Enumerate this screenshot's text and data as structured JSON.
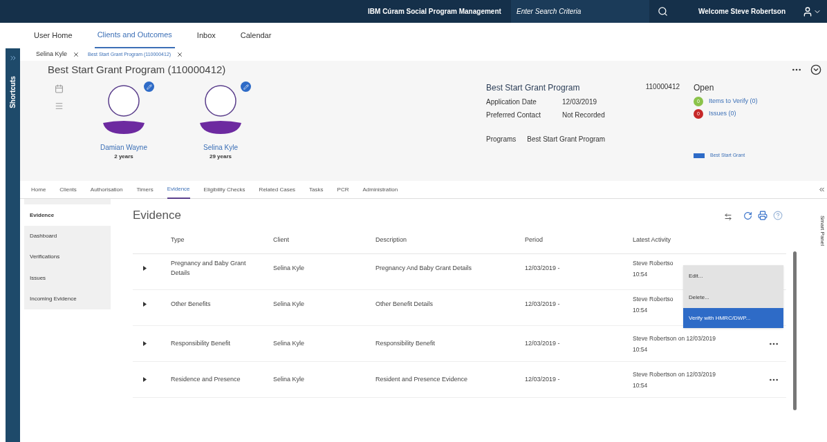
{
  "top_bar": {
    "product": "IBM Cúram Social Program Management",
    "search": {
      "placeholder": "Enter Search Criteria"
    },
    "welcome": "Welcome Steve Robertson"
  },
  "nav_tabs": [
    {
      "label": "User Home",
      "selected": false
    },
    {
      "label": "Clients and Outcomes",
      "selected": true
    },
    {
      "label": "Inbox",
      "selected": false
    },
    {
      "label": "Calendar",
      "selected": false
    }
  ],
  "shortcuts": {
    "label": "Shortcuts"
  },
  "open_tabs": [
    {
      "label": "Selina Kyle",
      "selected": false
    },
    {
      "label": "Best Start Grant Program (110000412)",
      "selected": true
    }
  ],
  "page_title": "Best Start Grant Program (110000412)",
  "clients": [
    {
      "name": "Damian Wayne",
      "age": "2 years"
    },
    {
      "name": "Selina Kyle",
      "age": "29 years"
    }
  ],
  "case": {
    "title": "Best Start Grant Program",
    "reference": "110000412",
    "fields": [
      {
        "label": "Application Date",
        "value": "12/03/2019"
      },
      {
        "label": "Preferred Contact",
        "value": "Not Recorded"
      }
    ],
    "programs_label": "Programs",
    "programs_value": "Best Start Grant Program"
  },
  "status": {
    "label": "Open",
    "links": [
      {
        "badge": "0",
        "text": "Items to Verify (0)",
        "color": "#8bc34a"
      },
      {
        "badge": "0",
        "text": "Issues (0)",
        "color": "#c62828"
      }
    ],
    "tag": "Best Start Grant"
  },
  "case_tabs": [
    {
      "label": "Home",
      "selected": false
    },
    {
      "label": "Clients",
      "selected": false
    },
    {
      "label": "Authorisation",
      "selected": false
    },
    {
      "label": "Timers",
      "selected": false
    },
    {
      "label": "Evidence",
      "selected": true
    },
    {
      "label": "Eligibility Checks",
      "selected": false
    },
    {
      "label": "Related Cases",
      "selected": false
    },
    {
      "label": "Tasks",
      "selected": false
    },
    {
      "label": "PCR",
      "selected": false
    },
    {
      "label": "Administration",
      "selected": false
    }
  ],
  "side_nav": [
    {
      "label": "Evidence",
      "selected": true
    },
    {
      "label": "Dashboard",
      "selected": false
    },
    {
      "label": "Verifications",
      "selected": false
    },
    {
      "label": "Issues",
      "selected": false
    },
    {
      "label": "Incoming Evidence",
      "selected": false
    }
  ],
  "evidence": {
    "title": "Evidence",
    "columns": [
      "Type",
      "Client",
      "Description",
      "Period",
      "Latest Activity"
    ],
    "rows": [
      {
        "type": "Pregnancy and Baby Grant Details",
        "client": "Selina Kyle",
        "description": "Pregnancy And Baby Grant Details",
        "period": "12/03/2019 -",
        "activity": "Steve Robertso",
        "time": "10:54",
        "menu_button": false
      },
      {
        "type": "Other Benefits",
        "client": "Selina Kyle",
        "description": "Other Benefit Details",
        "period": "12/03/2019 -",
        "activity": "Steve Robertso",
        "time": "10:54",
        "menu_button": false
      },
      {
        "type": "Responsibility Benefit",
        "client": "Selina Kyle",
        "description": "Responsibility Benefit",
        "period": "12/03/2019 -",
        "activity": "Steve Robertson on 12/03/2019",
        "time": "10:54",
        "menu_button": true
      },
      {
        "type": "Residence and Presence",
        "client": "Selina Kyle",
        "description": "Resident and Presence Evidence",
        "period": "12/03/2019 -",
        "activity": "Steve Robertson on 12/03/2019",
        "time": "10:54",
        "menu_button": true
      }
    ],
    "menu": [
      {
        "label": "Edit...",
        "selected": false
      },
      {
        "label": "Delete...",
        "selected": false
      },
      {
        "label": "Verify with HMRC/DWP...",
        "selected": true
      }
    ]
  },
  "smart_panel": {
    "label": "Smart Panel"
  }
}
